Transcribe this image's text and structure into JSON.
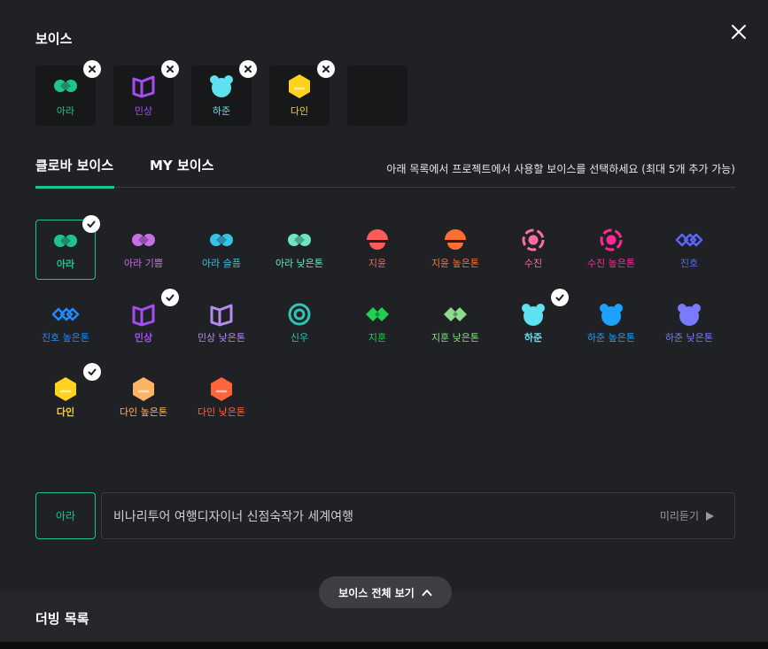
{
  "panel": {
    "title": "보이스",
    "close_icon": "close-icon"
  },
  "selected": [
    {
      "label": "아라",
      "color": "#1ec48c",
      "icon": "ara-icon"
    },
    {
      "label": "민상",
      "color": "#a64cf5",
      "icon": "minsang-icon"
    },
    {
      "label": "하준",
      "color": "#5ee1f0",
      "icon": "hajun-icon"
    },
    {
      "label": "다인",
      "color": "#ffd21e",
      "icon": "dain-icon"
    }
  ],
  "tabs": {
    "clova": "클로바 보이스",
    "my": "MY 보이스",
    "hint": "아래 목록에서 프로젝트에서 사용할 보이스를 선택하세요 (최대 5개 추가 가능)"
  },
  "voices": [
    {
      "label": "아라",
      "color": "#1ec48c",
      "shape": "ara",
      "checked": true,
      "current": true
    },
    {
      "label": "아라 기쁨",
      "color": "#c86ee6",
      "shape": "ara",
      "checked": false
    },
    {
      "label": "아라 슬픔",
      "color": "#35c3e6",
      "shape": "ara",
      "checked": false
    },
    {
      "label": "아라 낮은톤",
      "color": "#6ee6c3",
      "shape": "ara",
      "checked": false
    },
    {
      "label": "지윤",
      "color": "#ff5a5a",
      "shape": "jiyun",
      "checked": false
    },
    {
      "label": "지윤 높은톤",
      "color": "#ff6e32",
      "shape": "jiyun",
      "checked": false
    },
    {
      "label": "수진",
      "color": "#ff6ea0",
      "shape": "sujin",
      "checked": false
    },
    {
      "label": "수진 높은톤",
      "color": "#ff2896",
      "shape": "sujin",
      "checked": false
    },
    {
      "label": "진호",
      "color": "#5a64ff",
      "shape": "jinho",
      "checked": false
    },
    {
      "label": "진호 높은톤",
      "color": "#1e8cff",
      "shape": "jinho",
      "checked": false
    },
    {
      "label": "민상",
      "color": "#a64cf5",
      "shape": "minsang",
      "checked": true
    },
    {
      "label": "민상 낮은톤",
      "color": "#b48cf0",
      "shape": "minsang",
      "checked": false
    },
    {
      "label": "신우",
      "color": "#2ec4b6",
      "shape": "sinu",
      "checked": false
    },
    {
      "label": "지훈",
      "color": "#1ed250",
      "shape": "jihun",
      "checked": false
    },
    {
      "label": "지훈 낮은톤",
      "color": "#8cdc8c",
      "shape": "jihun",
      "checked": false
    },
    {
      "label": "하준",
      "color": "#5ee1f0",
      "shape": "hajun",
      "checked": true
    },
    {
      "label": "하준 높은톤",
      "color": "#1ea0ff",
      "shape": "hajun",
      "checked": false
    },
    {
      "label": "하준 낮은톤",
      "color": "#7a7aff",
      "shape": "hajun",
      "checked": false
    },
    {
      "label": "다인",
      "color": "#ffd21e",
      "shape": "dain",
      "checked": true
    },
    {
      "label": "다인 높은톤",
      "color": "#ffb464",
      "shape": "dain",
      "checked": false
    },
    {
      "label": "다인 낮은톤",
      "color": "#ff643c",
      "shape": "dain",
      "checked": false
    }
  ],
  "preview": {
    "voice_label": "아라",
    "text": "비나리투어 여행디자이너 신점숙작가 세계여행",
    "button_label": "미리듣기"
  },
  "view_all": {
    "label": "보이스 전체 보기"
  },
  "dubbing": {
    "title": "더빙 목록"
  },
  "colors": {
    "accent": "#1ec48c",
    "background": "#202124"
  }
}
